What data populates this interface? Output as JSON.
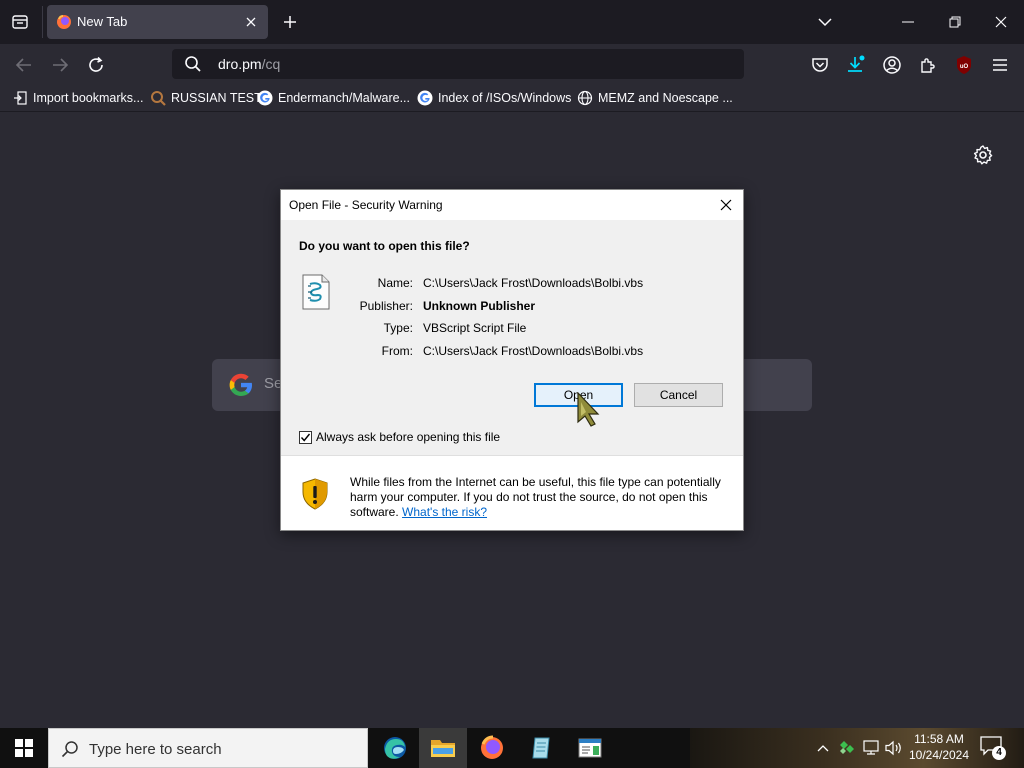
{
  "browser": {
    "tab": {
      "title": "New Tab"
    },
    "url": {
      "host": "dro.pm",
      "path": "/cq"
    },
    "bookmarks": [
      {
        "label": "Import bookmarks...",
        "icon": "import-icon"
      },
      {
        "label": "RUSSIAN TEST",
        "icon": "magnifier-favicon"
      },
      {
        "label": "Endermanch/Malware...",
        "icon": "google-favicon"
      },
      {
        "label": "Index of /ISOs/Windows",
        "icon": "google-favicon"
      },
      {
        "label": "MEMZ and Noescape ...",
        "icon": "globe-icon"
      }
    ],
    "search_placeholder": "Se"
  },
  "dialog": {
    "title": "Open File - Security Warning",
    "question": "Do you want to open this file?",
    "props": [
      {
        "label": "Name:",
        "value": "C:\\Users\\Jack Frost\\Downloads\\Bolbi.vbs",
        "bold": false
      },
      {
        "label": "Publisher:",
        "value": "Unknown Publisher",
        "bold": true
      },
      {
        "label": "Type:",
        "value": "VBScript Script File",
        "bold": false
      },
      {
        "label": "From:",
        "value": "C:\\Users\\Jack Frost\\Downloads\\Bolbi.vbs",
        "bold": false
      }
    ],
    "open_label": "Open",
    "cancel_label": "Cancel",
    "checkbox_label": "Always ask before opening this file",
    "checkbox_checked": true,
    "warning_text": "While files from the Internet can be useful, this file type can potentially harm your computer. If you do not trust the source, do not open this software.",
    "warning_link": "What's the risk?"
  },
  "taskbar": {
    "search_placeholder": "Type here to search",
    "time": "11:58 AM",
    "date": "10/24/2024",
    "notification_count": "4"
  },
  "colors": {
    "chrome_dark": "#1c1b22",
    "chrome": "#2b2a33",
    "tab_active": "#42414d",
    "accent": "#0078d7",
    "link": "#0066cc"
  }
}
